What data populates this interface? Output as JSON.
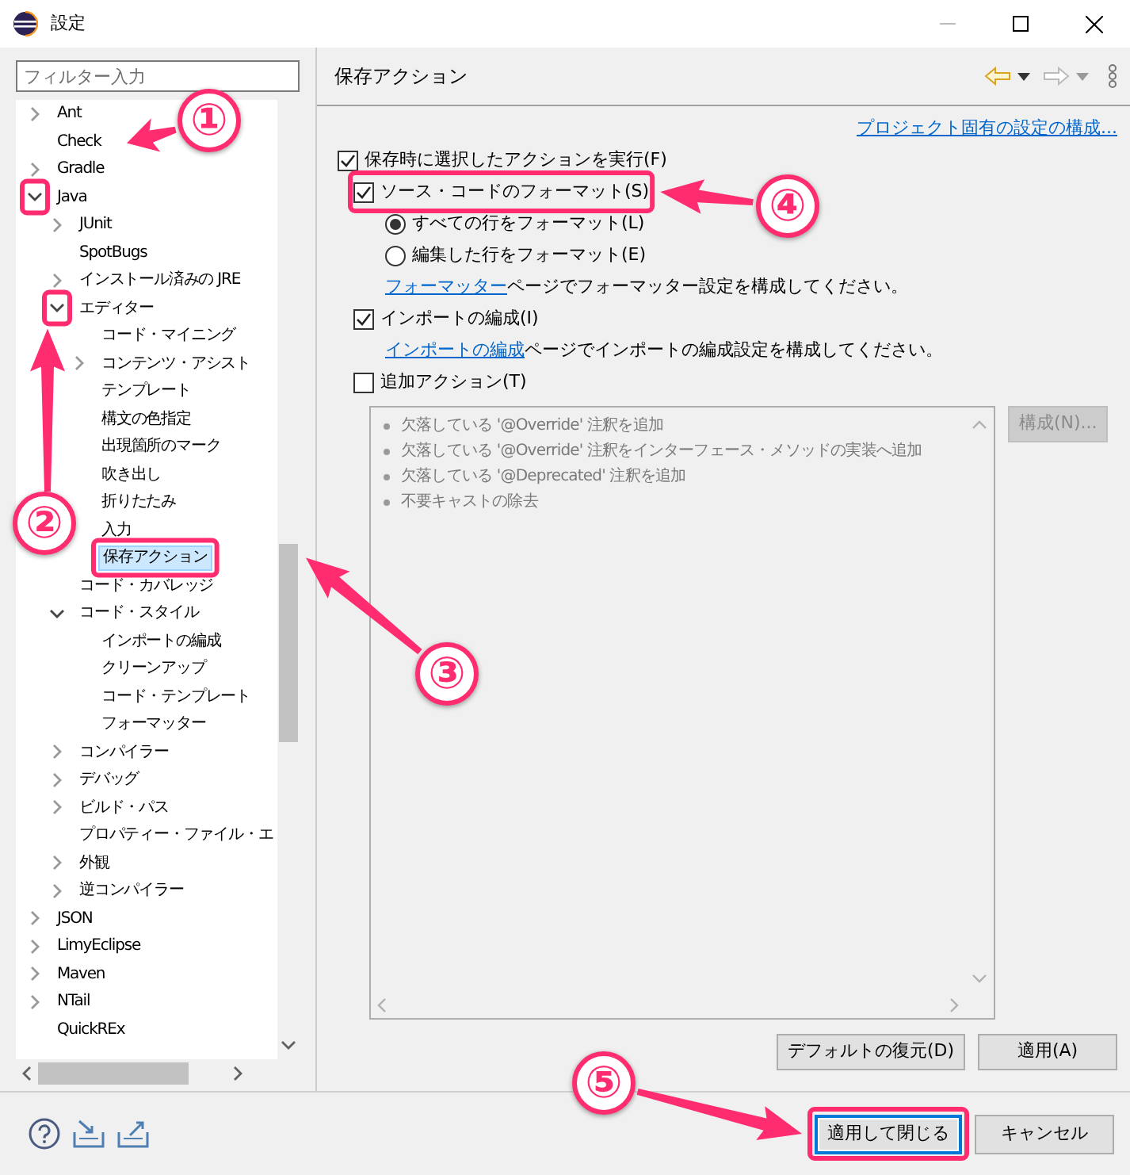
{
  "window": {
    "title": "設定"
  },
  "filter": {
    "placeholder": "フィルター入力"
  },
  "tree": [
    {
      "label": "Ant",
      "kind": "folder",
      "expanded": false,
      "selected": false
    },
    {
      "label": "Check",
      "kind": "leaf",
      "selected": false
    },
    {
      "label": "Gradle",
      "kind": "folder",
      "expanded": false,
      "selected": false
    },
    {
      "label": "Java",
      "kind": "folder",
      "expanded": true,
      "selected": false,
      "children": [
        {
          "label": "JUnit",
          "kind": "folder",
          "expanded": false,
          "selected": false
        },
        {
          "label": "SpotBugs",
          "kind": "leaf",
          "selected": false
        },
        {
          "label": "インストール済みの JRE",
          "kind": "folder",
          "expanded": false,
          "selected": false
        },
        {
          "label": "エディター",
          "kind": "folder",
          "expanded": true,
          "selected": false,
          "children": [
            {
              "label": "コード・マイニング",
              "kind": "leaf",
              "selected": false
            },
            {
              "label": "コンテンツ・アシスト",
              "kind": "folder",
              "expanded": false,
              "selected": false
            },
            {
              "label": "テンプレート",
              "kind": "leaf",
              "selected": false
            },
            {
              "label": "構文の色指定",
              "kind": "leaf",
              "selected": false
            },
            {
              "label": "出現箇所のマーク",
              "kind": "leaf",
              "selected": false
            },
            {
              "label": "吹き出し",
              "kind": "leaf",
              "selected": false
            },
            {
              "label": "折りたたみ",
              "kind": "leaf",
              "selected": false
            },
            {
              "label": "入力",
              "kind": "leaf",
              "selected": false
            },
            {
              "label": "保存アクション",
              "kind": "leaf",
              "selected": true
            }
          ]
        },
        {
          "label": "コード・カバレッジ",
          "kind": "leaf",
          "selected": false
        },
        {
          "label": "コード・スタイル",
          "kind": "folder",
          "expanded": true,
          "selected": false,
          "children": [
            {
              "label": "インポートの編成",
              "kind": "leaf",
              "selected": false
            },
            {
              "label": "クリーンアップ",
              "kind": "leaf",
              "selected": false
            },
            {
              "label": "コード・テンプレート",
              "kind": "leaf",
              "selected": false
            },
            {
              "label": "フォーマッター",
              "kind": "leaf",
              "selected": false
            }
          ]
        },
        {
          "label": "コンパイラー",
          "kind": "folder",
          "expanded": false,
          "selected": false
        },
        {
          "label": "デバッグ",
          "kind": "folder",
          "expanded": false,
          "selected": false
        },
        {
          "label": "ビルド・パス",
          "kind": "folder",
          "expanded": false,
          "selected": false
        },
        {
          "label": "プロパティー・ファイル・エ",
          "kind": "leaf",
          "selected": false
        },
        {
          "label": "外観",
          "kind": "folder",
          "expanded": false,
          "selected": false
        },
        {
          "label": "逆コンパイラー",
          "kind": "folder",
          "expanded": false,
          "selected": false
        }
      ]
    },
    {
      "label": "JSON",
      "kind": "folder",
      "expanded": false,
      "selected": false
    },
    {
      "label": "LimyEclipse",
      "kind": "folder",
      "expanded": false,
      "selected": false
    },
    {
      "label": "Maven",
      "kind": "folder",
      "expanded": false,
      "selected": false
    },
    {
      "label": "NTail",
      "kind": "folder",
      "expanded": false,
      "selected": false
    },
    {
      "label": "QuickREx",
      "kind": "leaf",
      "selected": false
    }
  ],
  "page": {
    "title": "保存アクション",
    "project_link": "プロジェクト固有の設定の構成...",
    "options": [
      {
        "kind": "checkbox",
        "label": "保存時に選択したアクションを実行(F)",
        "checked": true
      },
      {
        "kind": "group",
        "children": [
          {
            "kind": "checkbox",
            "label": "ソース・コードのフォーマット(S)",
            "checked": true,
            "children": [
              {
                "kind": "radio",
                "label": "すべての行をフォーマット(L)",
                "selected": true
              },
              {
                "kind": "radio",
                "label": "編集した行をフォーマット(E)",
                "selected": false
              },
              {
                "kind": "note",
                "link": "フォーマッター",
                "text": "ページでフォーマッター設定を構成してください。"
              }
            ]
          },
          {
            "kind": "checkbox",
            "label": "インポートの編成(I)",
            "checked": true,
            "children": [
              {
                "kind": "note",
                "link": "インポートの編成",
                "text": "ページでインポートの編成設定を構成してください。"
              }
            ]
          },
          {
            "kind": "checkbox",
            "label": "追加アクション(T)",
            "checked": false
          }
        ]
      }
    ],
    "actions": {
      "disabled": true,
      "items": [
        "欠落している '@Override' 注釈を追加",
        "欠落している '@Override' 注釈をインターフェース・メソッドの実装へ追加",
        "欠落している '@Deprecated' 注釈を追加",
        "不要キャストの除去"
      ],
      "configure": "構成(N)..."
    },
    "buttons": [
      "デフォルトの復元(D)",
      "適用(A)"
    ]
  },
  "footer": {
    "buttons": [
      {
        "label": "適用して閉じる",
        "primary": true
      },
      {
        "label": "キャンセル",
        "primary": false
      }
    ]
  },
  "annotations": [
    {
      "label": "①"
    },
    {
      "label": "②"
    },
    {
      "label": "③"
    },
    {
      "label": "④"
    },
    {
      "label": "⑤"
    }
  ]
}
